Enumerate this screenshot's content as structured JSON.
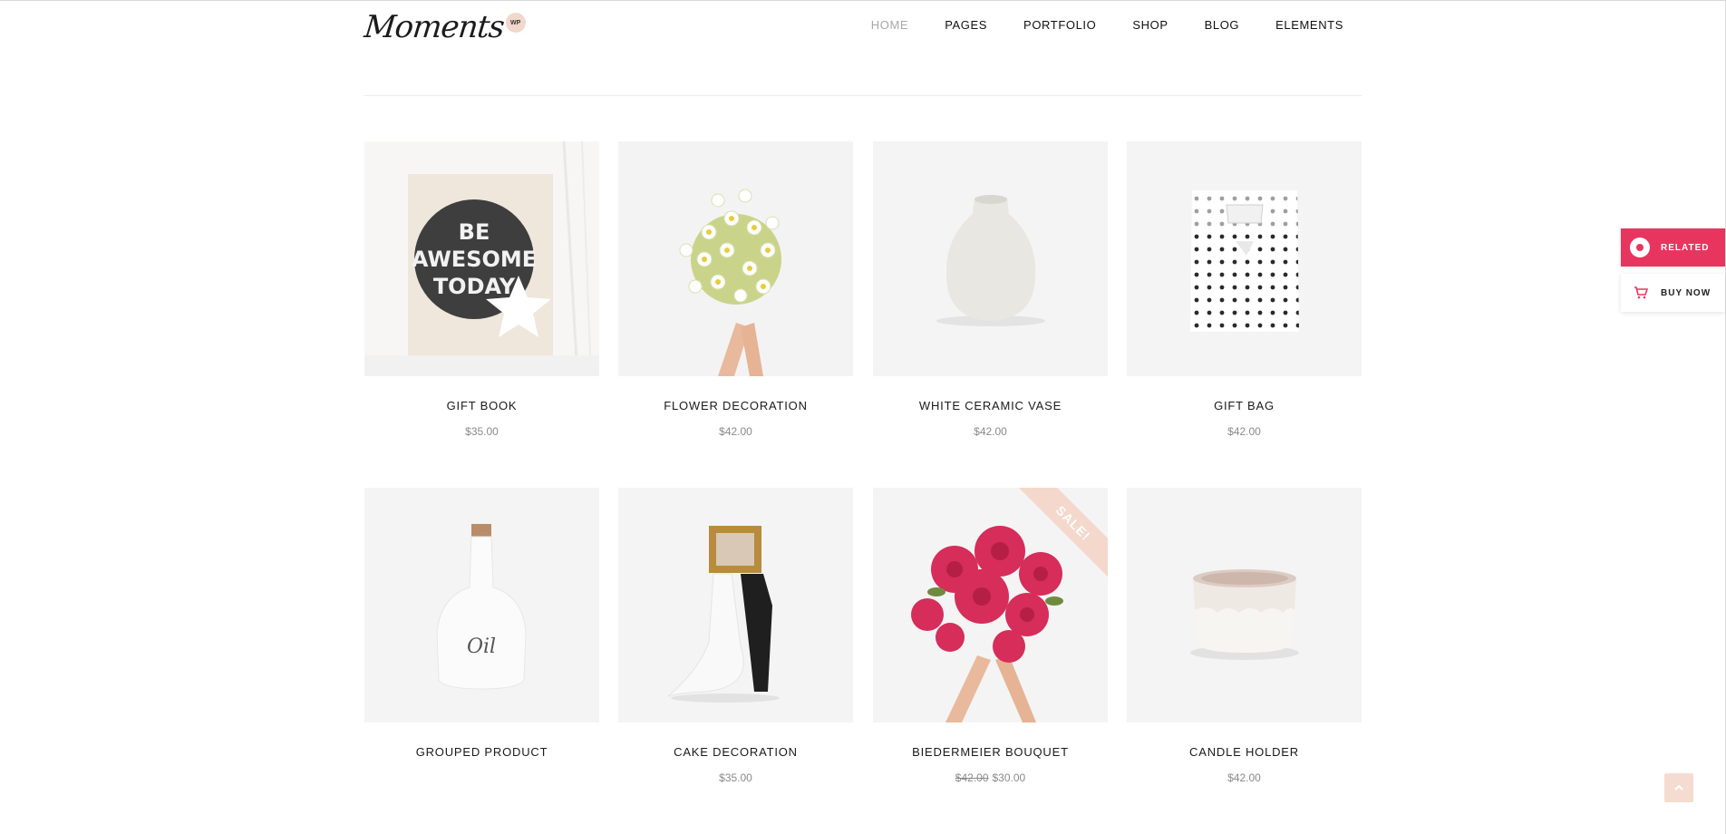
{
  "brand": {
    "logo_text": "Moments",
    "badge": "WP"
  },
  "nav": {
    "items": [
      {
        "label": "HOME",
        "active": true
      },
      {
        "label": "PAGES"
      },
      {
        "label": "PORTFOLIO"
      },
      {
        "label": "SHOP"
      },
      {
        "label": "BLOG"
      },
      {
        "label": "ELEMENTS"
      }
    ]
  },
  "products": [
    {
      "title": "GIFT BOOK",
      "price": "$35.00",
      "image": "be-awesome-today-sign"
    },
    {
      "title": "FLOWER DECORATION",
      "price": "$42.00",
      "image": "daisy-bouquet"
    },
    {
      "title": "WHITE CERAMIC VASE",
      "price": "$42.00",
      "image": "ceramic-vase"
    },
    {
      "title": "GIFT BAG",
      "price": "$42.00",
      "image": "polka-dot-gift-bag"
    },
    {
      "title": "GROUPED PRODUCT",
      "price": "",
      "image": "oil-bottle"
    },
    {
      "title": "CAKE DECORATION",
      "price": "$35.00",
      "image": "cake-topper-couple"
    },
    {
      "title": "BIEDERMEIER BOUQUET",
      "old_price": "$42.00",
      "price": "$30.00",
      "sale_badge": "SALE!",
      "image": "pink-ranunculus-bouquet"
    },
    {
      "title": "CANDLE HOLDER",
      "price": "$42.00",
      "image": "ceramic-candle-holder"
    }
  ],
  "product_images": {
    "sign_text": [
      "BE",
      "AWESOME",
      "TODAY"
    ],
    "bottle_text": "Oil"
  },
  "sidebar_widgets": {
    "related_label": "RELATED",
    "buy_label": "BUY NOW"
  },
  "colors": {
    "accent": "#e8355f",
    "sale_ribbon": "#f5d8cc",
    "back_to_top": "#f5dcd1"
  }
}
